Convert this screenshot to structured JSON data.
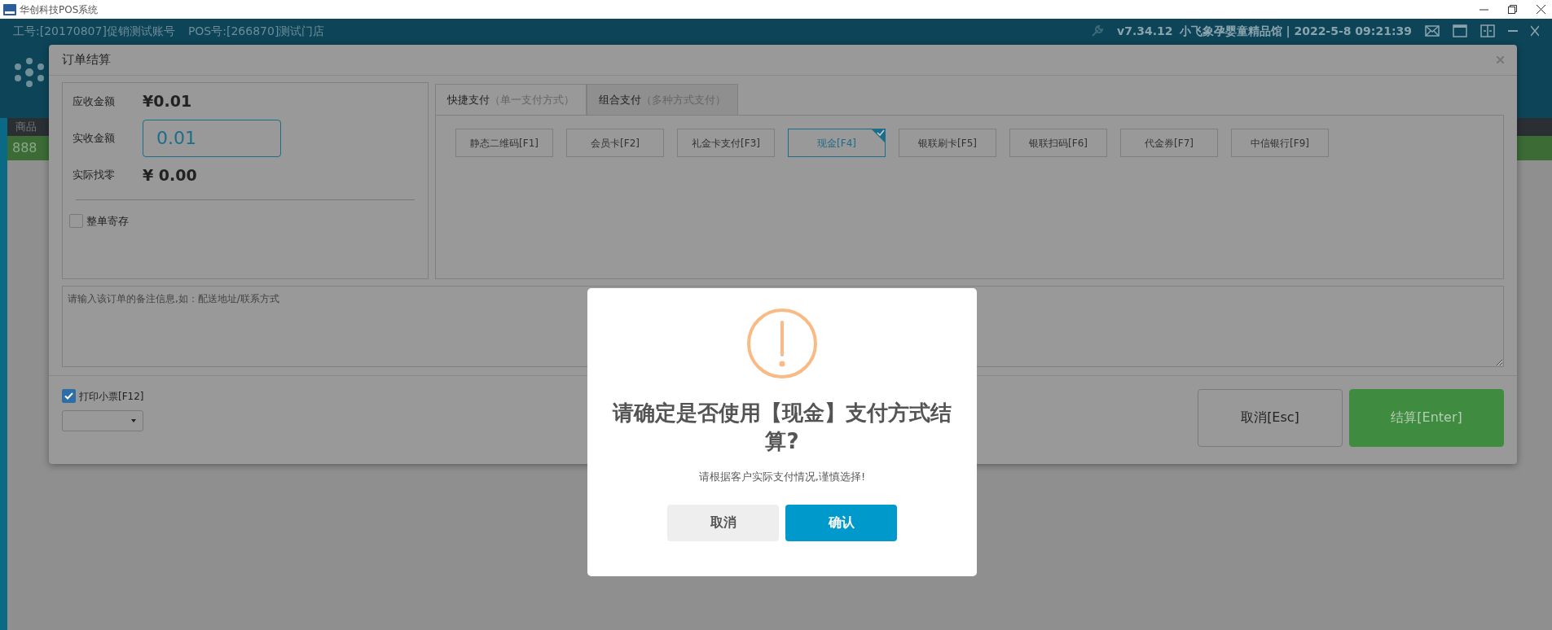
{
  "window": {
    "title": "华创科技POS系统"
  },
  "header": {
    "operator": "工号:[20170807]促销测试账号",
    "pos": "POS号:[266870]测试门店",
    "version": "v7.34.12",
    "store": "小飞象孕婴童精品馆 | 2022-5-8 09:21:39"
  },
  "background_table": {
    "header_cell": "商品",
    "row_cell": "888"
  },
  "order_dialog": {
    "title": "订单结算",
    "amounts": [
      {
        "label": "应收金额",
        "value": "¥0.01",
        "kind": "text"
      },
      {
        "label": "实收金额",
        "value": "0.01",
        "kind": "input"
      },
      {
        "label": "实际找零",
        "value": "¥ 0.00",
        "kind": "text"
      }
    ],
    "store_order": {
      "label": "整单寄存",
      "checked": false
    },
    "tabs": [
      {
        "label": "快捷支付",
        "hint": "（单一支付方式）",
        "selected": true
      },
      {
        "label": "组合支付",
        "hint": "（多种方式支付）",
        "selected": false
      }
    ],
    "payment_methods": [
      {
        "label": "静态二维码[F1]",
        "selected": false
      },
      {
        "label": "会员卡[F2]",
        "selected": false
      },
      {
        "label": "礼金卡支付[F3]",
        "selected": false
      },
      {
        "label": "现金[F4]",
        "selected": true
      },
      {
        "label": "银联刷卡[F5]",
        "selected": false
      },
      {
        "label": "银联扫码[F6]",
        "selected": false
      },
      {
        "label": "代金券[F7]",
        "selected": false
      },
      {
        "label": "中信银行[F9]",
        "selected": false
      }
    ],
    "note": {
      "placeholder": "请输入该订单的备注信息,如：配送地址/联系方式"
    },
    "print_receipt": {
      "label": "打印小票[F12]",
      "checked": true
    },
    "buttons": [
      {
        "label": "取消[Esc]",
        "kind": "cancel"
      },
      {
        "label": "结算[Enter]",
        "kind": "confirm"
      }
    ]
  },
  "confirm_dialog": {
    "title": "请确定是否使用【现金】支付方式结算?",
    "message": "请根据客户实际支付情况,谨慎选择!",
    "buttons": [
      {
        "label": "取消",
        "kind": "cancel"
      },
      {
        "label": "确认",
        "kind": "confirm"
      }
    ]
  }
}
